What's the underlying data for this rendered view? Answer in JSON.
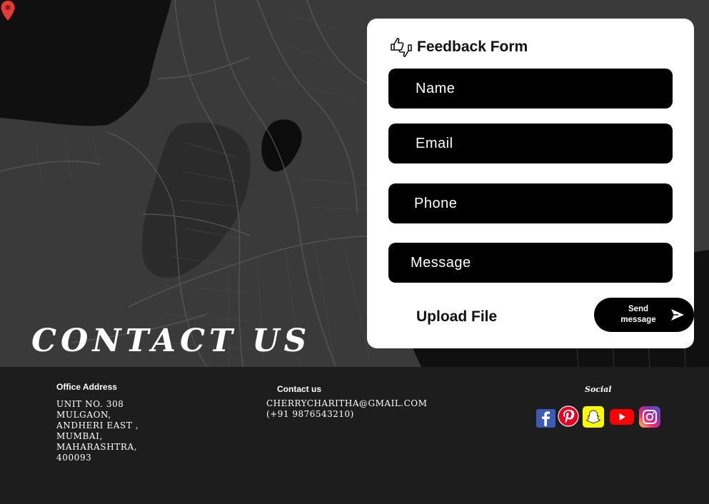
{
  "hero": {
    "title": "Contact us"
  },
  "form": {
    "title": "Feedback Form",
    "fields": {
      "name": "Name",
      "email": "Email",
      "phone": "Phone",
      "message": "Message"
    },
    "upload_label": "Upload File",
    "send_label_line1": "Send",
    "send_label_line2": "message"
  },
  "footer": {
    "office": {
      "heading": "Office Address",
      "address": "Unit No. 308\nMulgaon,\nAndheri East ,\nMumbai,\n Maharashtra,\n400093"
    },
    "contact": {
      "heading": "Contact us",
      "email": "cherrycharitha@gmail.com",
      "phone": "(+91 9876543210)"
    },
    "social": {
      "heading": "Social",
      "icons": [
        "facebook-icon",
        "pinterest-icon",
        "snapchat-icon",
        "youtube-icon",
        "instagram-icon"
      ]
    }
  },
  "colors": {
    "map_land": "#3a3a3a",
    "map_water": "#101010",
    "pin": "#e53935",
    "card": "#ffffff",
    "field": "#000000",
    "footer": "#1d1d1d"
  }
}
